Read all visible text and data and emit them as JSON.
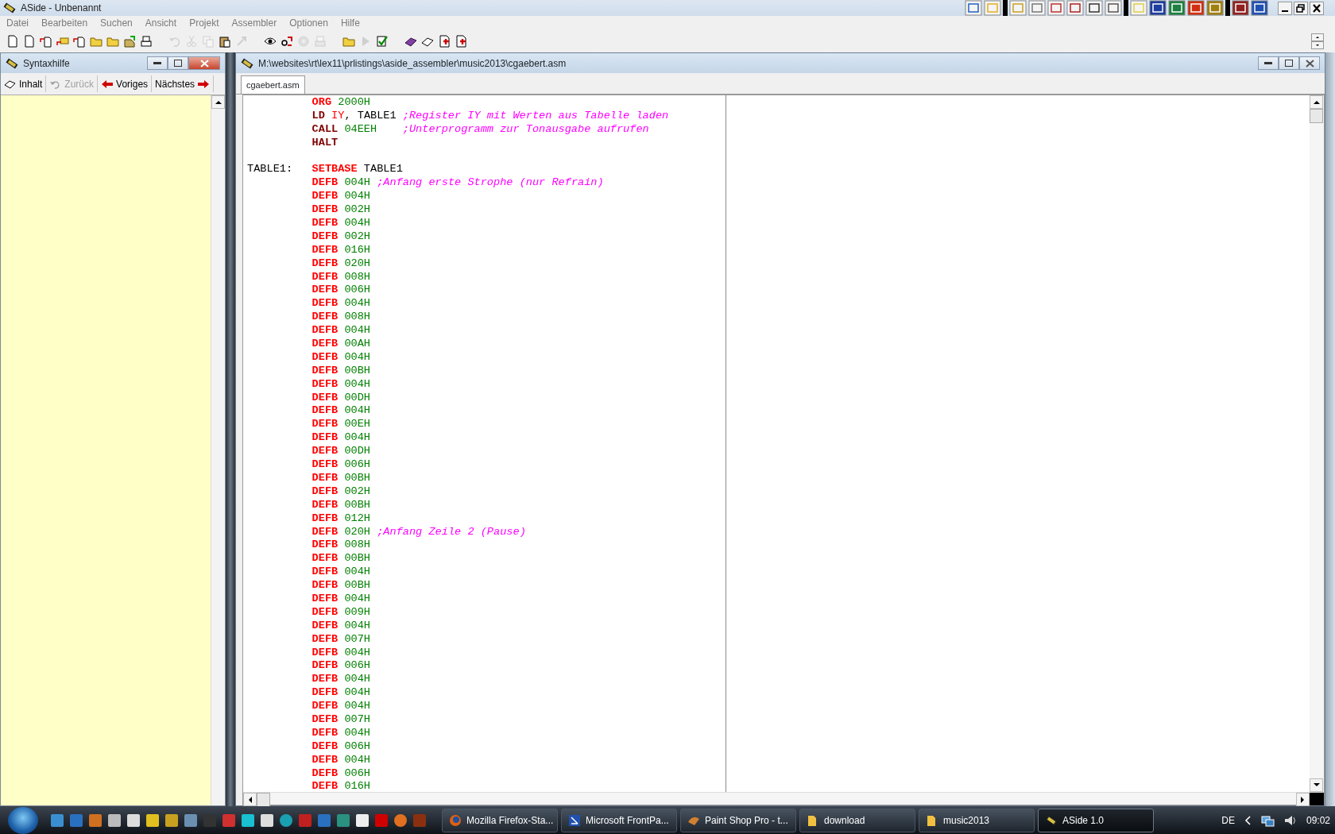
{
  "window": {
    "title": "ASide - Unbenannt"
  },
  "menu": [
    "Datei",
    "Bearbeiten",
    "Suchen",
    "Ansicht",
    "Projekt",
    "Assembler",
    "Optionen",
    "Hilfe"
  ],
  "toolbar": [
    {
      "disabled": false
    },
    {
      "disabled": false
    },
    {
      "disabled": false
    },
    {
      "disabled": false
    },
    {
      "disabled": false
    },
    {
      "disabled": false
    },
    {
      "disabled": false
    },
    {
      "disabled": false
    },
    {
      "disabled": false
    },
    {
      "disabled": true
    },
    {
      "disabled": true
    },
    {
      "disabled": true
    },
    {
      "disabled": false
    },
    {
      "disabled": true
    },
    {
      "disabled": false
    },
    {
      "disabled": false
    },
    {
      "disabled": true
    },
    {
      "disabled": true
    },
    {
      "disabled": false
    },
    {
      "disabled": true
    },
    {
      "disabled": false
    },
    {
      "disabled": false
    },
    {
      "disabled": false
    },
    {
      "disabled": false
    },
    {
      "disabled": false
    }
  ],
  "help_panel": {
    "title": "Syntaxhilfe",
    "buttons": [
      {
        "label": "Inhalt",
        "disabled": false
      },
      {
        "label": "Zurück",
        "disabled": true
      },
      {
        "label": "Voriges",
        "disabled": false
      },
      {
        "label": "Nächstes",
        "disabled": false
      }
    ]
  },
  "editor": {
    "title": "M:\\websites\\rt\\lex11\\prlistings\\aside_assembler\\music2013\\cgaebert.asm",
    "tabs": [
      {
        "label": "cgaebert.asm",
        "selected": true
      }
    ],
    "lines": [
      {
        "kind": "code",
        "tokens": [
          {
            "kind": "directive",
            "text": "ORG"
          },
          {
            "kind": "number",
            "text": "2000H"
          }
        ]
      },
      {
        "kind": "code",
        "tokens": [
          {
            "kind": "instruction",
            "text": "LD"
          },
          {
            "kind": "register",
            "text": "IY"
          },
          {
            "kind": "punct",
            "text": ","
          },
          {
            "kind": "symbol",
            "text": "TABLE1"
          }
        ],
        "comment": ";Register IY mit Werten aus Tabelle laden"
      },
      {
        "kind": "code",
        "tokens": [
          {
            "kind": "instruction",
            "text": "CALL"
          },
          {
            "kind": "number",
            "text": "04EEH"
          }
        ],
        "comment": ";Unterprogramm zur Tonausgabe aufrufen"
      },
      {
        "kind": "code",
        "tokens": [
          {
            "kind": "instruction",
            "text": "HALT"
          }
        ]
      },
      {
        "kind": "blank"
      },
      {
        "kind": "data",
        "label": "TABLE1:",
        "tokens": [
          {
            "kind": "directive",
            "text": "SETBASE"
          },
          {
            "kind": "symbol",
            "text": "TABLE1"
          }
        ]
      },
      {
        "kind": "data",
        "tokens": [
          {
            "kind": "directive",
            "text": "DEFB"
          },
          {
            "kind": "number",
            "text": "004H"
          }
        ],
        "comment": ";Anfang erste Strophe (nur Refrain)"
      },
      {
        "kind": "data",
        "tokens": [
          {
            "kind": "directive",
            "text": "DEFB"
          },
          {
            "kind": "number",
            "text": "004H"
          }
        ]
      },
      {
        "kind": "data",
        "tokens": [
          {
            "kind": "directive",
            "text": "DEFB"
          },
          {
            "kind": "number",
            "text": "002H"
          }
        ]
      },
      {
        "kind": "data",
        "tokens": [
          {
            "kind": "directive",
            "text": "DEFB"
          },
          {
            "kind": "number",
            "text": "004H"
          }
        ]
      },
      {
        "kind": "data",
        "tokens": [
          {
            "kind": "directive",
            "text": "DEFB"
          },
          {
            "kind": "number",
            "text": "002H"
          }
        ]
      },
      {
        "kind": "data",
        "tokens": [
          {
            "kind": "directive",
            "text": "DEFB"
          },
          {
            "kind": "number",
            "text": "016H"
          }
        ]
      },
      {
        "kind": "data",
        "tokens": [
          {
            "kind": "directive",
            "text": "DEFB"
          },
          {
            "kind": "number",
            "text": "020H"
          }
        ]
      },
      {
        "kind": "data",
        "tokens": [
          {
            "kind": "directive",
            "text": "DEFB"
          },
          {
            "kind": "number",
            "text": "008H"
          }
        ]
      },
      {
        "kind": "data",
        "tokens": [
          {
            "kind": "directive",
            "text": "DEFB"
          },
          {
            "kind": "number",
            "text": "006H"
          }
        ]
      },
      {
        "kind": "data",
        "tokens": [
          {
            "kind": "directive",
            "text": "DEFB"
          },
          {
            "kind": "number",
            "text": "004H"
          }
        ]
      },
      {
        "kind": "data",
        "tokens": [
          {
            "kind": "directive",
            "text": "DEFB"
          },
          {
            "kind": "number",
            "text": "008H"
          }
        ]
      },
      {
        "kind": "data",
        "tokens": [
          {
            "kind": "directive",
            "text": "DEFB"
          },
          {
            "kind": "number",
            "text": "004H"
          }
        ]
      },
      {
        "kind": "data",
        "tokens": [
          {
            "kind": "directive",
            "text": "DEFB"
          },
          {
            "kind": "number",
            "text": "00AH"
          }
        ]
      },
      {
        "kind": "data",
        "tokens": [
          {
            "kind": "directive",
            "text": "DEFB"
          },
          {
            "kind": "number",
            "text": "004H"
          }
        ]
      },
      {
        "kind": "data",
        "tokens": [
          {
            "kind": "directive",
            "text": "DEFB"
          },
          {
            "kind": "number",
            "text": "00BH"
          }
        ]
      },
      {
        "kind": "data",
        "tokens": [
          {
            "kind": "directive",
            "text": "DEFB"
          },
          {
            "kind": "number",
            "text": "004H"
          }
        ]
      },
      {
        "kind": "data",
        "tokens": [
          {
            "kind": "directive",
            "text": "DEFB"
          },
          {
            "kind": "number",
            "text": "00DH"
          }
        ]
      },
      {
        "kind": "data",
        "tokens": [
          {
            "kind": "directive",
            "text": "DEFB"
          },
          {
            "kind": "number",
            "text": "004H"
          }
        ]
      },
      {
        "kind": "data",
        "tokens": [
          {
            "kind": "directive",
            "text": "DEFB"
          },
          {
            "kind": "number",
            "text": "00EH"
          }
        ]
      },
      {
        "kind": "data",
        "tokens": [
          {
            "kind": "directive",
            "text": "DEFB"
          },
          {
            "kind": "number",
            "text": "004H"
          }
        ]
      },
      {
        "kind": "data",
        "tokens": [
          {
            "kind": "directive",
            "text": "DEFB"
          },
          {
            "kind": "number",
            "text": "00DH"
          }
        ]
      },
      {
        "kind": "data",
        "tokens": [
          {
            "kind": "directive",
            "text": "DEFB"
          },
          {
            "kind": "number",
            "text": "006H"
          }
        ]
      },
      {
        "kind": "data",
        "tokens": [
          {
            "kind": "directive",
            "text": "DEFB"
          },
          {
            "kind": "number",
            "text": "00BH"
          }
        ]
      },
      {
        "kind": "data",
        "tokens": [
          {
            "kind": "directive",
            "text": "DEFB"
          },
          {
            "kind": "number",
            "text": "002H"
          }
        ]
      },
      {
        "kind": "data",
        "tokens": [
          {
            "kind": "directive",
            "text": "DEFB"
          },
          {
            "kind": "number",
            "text": "00BH"
          }
        ]
      },
      {
        "kind": "data",
        "tokens": [
          {
            "kind": "directive",
            "text": "DEFB"
          },
          {
            "kind": "number",
            "text": "012H"
          }
        ]
      },
      {
        "kind": "data",
        "tokens": [
          {
            "kind": "directive",
            "text": "DEFB"
          },
          {
            "kind": "number",
            "text": "020H"
          }
        ],
        "comment": ";Anfang Zeile 2 (Pause)"
      },
      {
        "kind": "data",
        "tokens": [
          {
            "kind": "directive",
            "text": "DEFB"
          },
          {
            "kind": "number",
            "text": "008H"
          }
        ]
      },
      {
        "kind": "data",
        "tokens": [
          {
            "kind": "directive",
            "text": "DEFB"
          },
          {
            "kind": "number",
            "text": "00BH"
          }
        ]
      },
      {
        "kind": "data",
        "tokens": [
          {
            "kind": "directive",
            "text": "DEFB"
          },
          {
            "kind": "number",
            "text": "004H"
          }
        ]
      },
      {
        "kind": "data",
        "tokens": [
          {
            "kind": "directive",
            "text": "DEFB"
          },
          {
            "kind": "number",
            "text": "00BH"
          }
        ]
      },
      {
        "kind": "data",
        "tokens": [
          {
            "kind": "directive",
            "text": "DEFB"
          },
          {
            "kind": "number",
            "text": "004H"
          }
        ]
      },
      {
        "kind": "data",
        "tokens": [
          {
            "kind": "directive",
            "text": "DEFB"
          },
          {
            "kind": "number",
            "text": "009H"
          }
        ]
      },
      {
        "kind": "data",
        "tokens": [
          {
            "kind": "directive",
            "text": "DEFB"
          },
          {
            "kind": "number",
            "text": "004H"
          }
        ]
      },
      {
        "kind": "data",
        "tokens": [
          {
            "kind": "directive",
            "text": "DEFB"
          },
          {
            "kind": "number",
            "text": "007H"
          }
        ]
      },
      {
        "kind": "data",
        "tokens": [
          {
            "kind": "directive",
            "text": "DEFB"
          },
          {
            "kind": "number",
            "text": "004H"
          }
        ]
      },
      {
        "kind": "data",
        "tokens": [
          {
            "kind": "directive",
            "text": "DEFB"
          },
          {
            "kind": "number",
            "text": "006H"
          }
        ]
      },
      {
        "kind": "data",
        "tokens": [
          {
            "kind": "directive",
            "text": "DEFB"
          },
          {
            "kind": "number",
            "text": "004H"
          }
        ]
      },
      {
        "kind": "data",
        "tokens": [
          {
            "kind": "directive",
            "text": "DEFB"
          },
          {
            "kind": "number",
            "text": "004H"
          }
        ]
      },
      {
        "kind": "data",
        "tokens": [
          {
            "kind": "directive",
            "text": "DEFB"
          },
          {
            "kind": "number",
            "text": "004H"
          }
        ]
      },
      {
        "kind": "data",
        "tokens": [
          {
            "kind": "directive",
            "text": "DEFB"
          },
          {
            "kind": "number",
            "text": "007H"
          }
        ]
      },
      {
        "kind": "data",
        "tokens": [
          {
            "kind": "directive",
            "text": "DEFB"
          },
          {
            "kind": "number",
            "text": "004H"
          }
        ]
      },
      {
        "kind": "data",
        "tokens": [
          {
            "kind": "directive",
            "text": "DEFB"
          },
          {
            "kind": "number",
            "text": "006H"
          }
        ]
      },
      {
        "kind": "data",
        "tokens": [
          {
            "kind": "directive",
            "text": "DEFB"
          },
          {
            "kind": "number",
            "text": "004H"
          }
        ]
      },
      {
        "kind": "data",
        "tokens": [
          {
            "kind": "directive",
            "text": "DEFB"
          },
          {
            "kind": "number",
            "text": "006H"
          }
        ]
      },
      {
        "kind": "data",
        "tokens": [
          {
            "kind": "directive",
            "text": "DEFB"
          },
          {
            "kind": "number",
            "text": "016H"
          }
        ]
      }
    ]
  },
  "taskbar": {
    "tasks": [
      {
        "label": "Mozilla Firefox-Sta...",
        "selected": false
      },
      {
        "label": "Microsoft FrontPa...",
        "selected": false
      },
      {
        "label": "Paint Shop Pro - t...",
        "selected": false
      },
      {
        "label": "download",
        "selected": false
      },
      {
        "label": "music2013",
        "selected": false
      },
      {
        "label": "ASide 1.0",
        "selected": true
      }
    ],
    "language": "DE",
    "clock": "09:02"
  }
}
